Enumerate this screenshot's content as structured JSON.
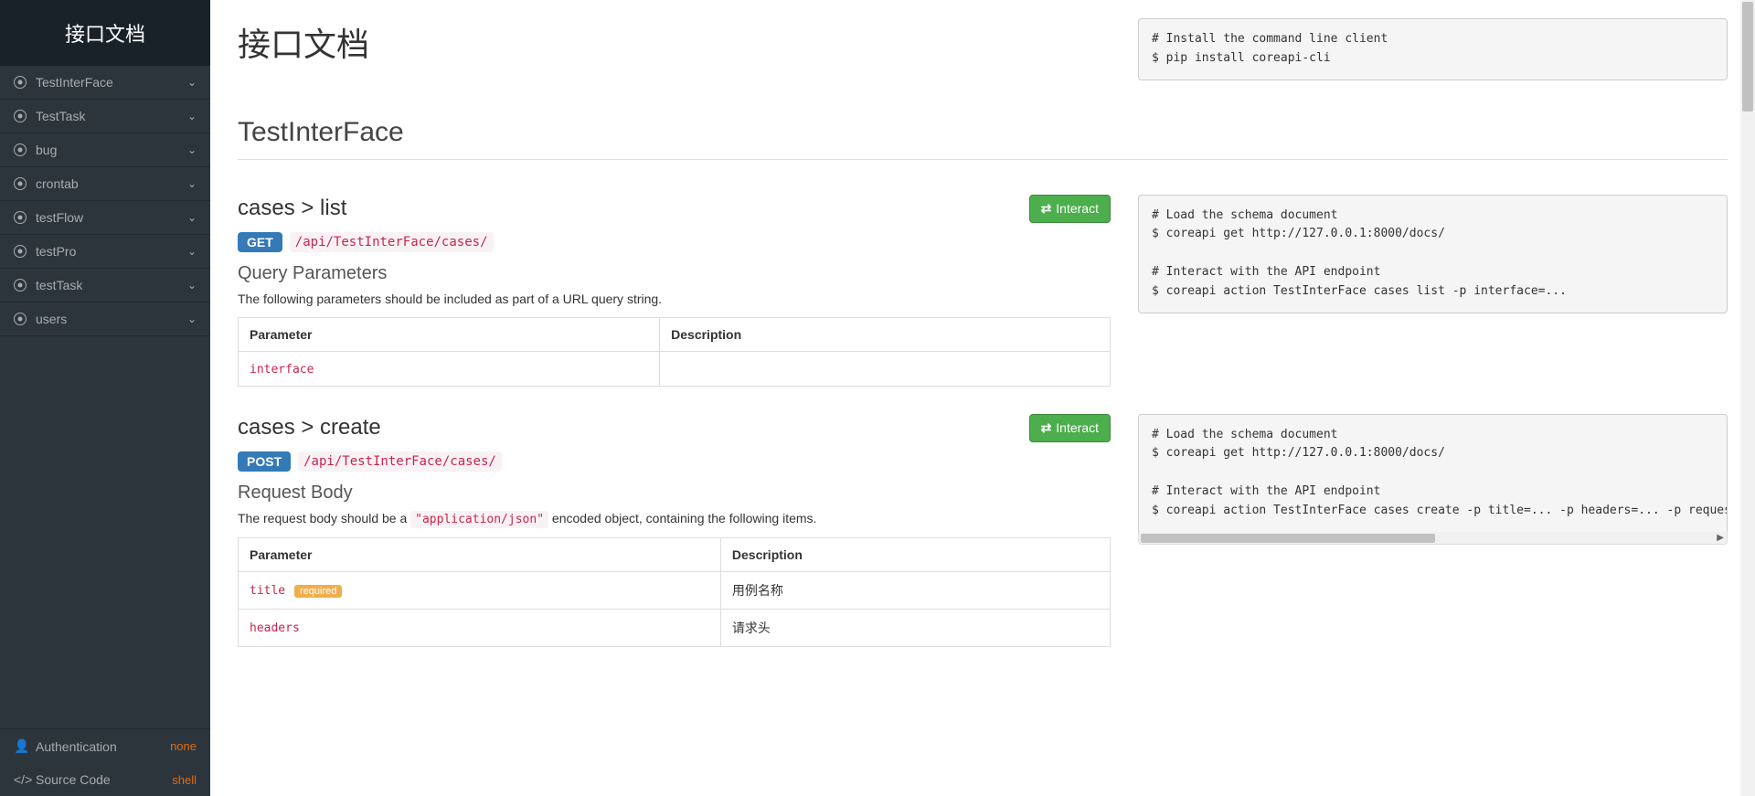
{
  "sidebar": {
    "title": "接口文档",
    "items": [
      {
        "label": "TestInterFace"
      },
      {
        "label": "TestTask"
      },
      {
        "label": "bug"
      },
      {
        "label": "crontab"
      },
      {
        "label": "testFlow"
      },
      {
        "label": "testPro"
      },
      {
        "label": "testTask"
      },
      {
        "label": "users"
      }
    ],
    "footer": {
      "auth_label": "Authentication",
      "auth_value": "none",
      "source_label": "Source Code",
      "source_value": "shell"
    }
  },
  "main": {
    "page_title": "接口文档",
    "install_code": "# Install the command line client\n$ pip install coreapi-cli",
    "section_title": "TestInterFace",
    "endpoints": [
      {
        "title": "cases > list",
        "method": "GET",
        "path": "/api/TestInterFace/cases/",
        "interact_label": "Interact",
        "sub_title": "Query Parameters",
        "desc": "The following parameters should be included as part of a URL query string.",
        "table_headers": {
          "param": "Parameter",
          "desc": "Description"
        },
        "params": [
          {
            "name": "interface",
            "required": false,
            "desc": ""
          }
        ],
        "code": "# Load the schema document\n$ coreapi get http://127.0.0.1:8000/docs/\n\n# Interact with the API endpoint\n$ coreapi action TestInterFace cases list -p interface=..."
      },
      {
        "title": "cases > create",
        "method": "POST",
        "path": "/api/TestInterFace/cases/",
        "interact_label": "Interact",
        "sub_title": "Request Body",
        "desc_pre": "The request body should be a ",
        "desc_code": "\"application/json\"",
        "desc_post": " encoded object, containing the following items.",
        "table_headers": {
          "param": "Parameter",
          "desc": "Description"
        },
        "params": [
          {
            "name": "title",
            "required": true,
            "required_label": "required",
            "desc": "用例名称"
          },
          {
            "name": "headers",
            "required": false,
            "desc": "请求头"
          }
        ],
        "code": "# Load the schema document\n$ coreapi get http://127.0.0.1:8000/docs/\n\n# Interact with the API endpoint\n$ coreapi action TestInterFace cases create -p title=... -p headers=... -p request=..."
      }
    ]
  }
}
